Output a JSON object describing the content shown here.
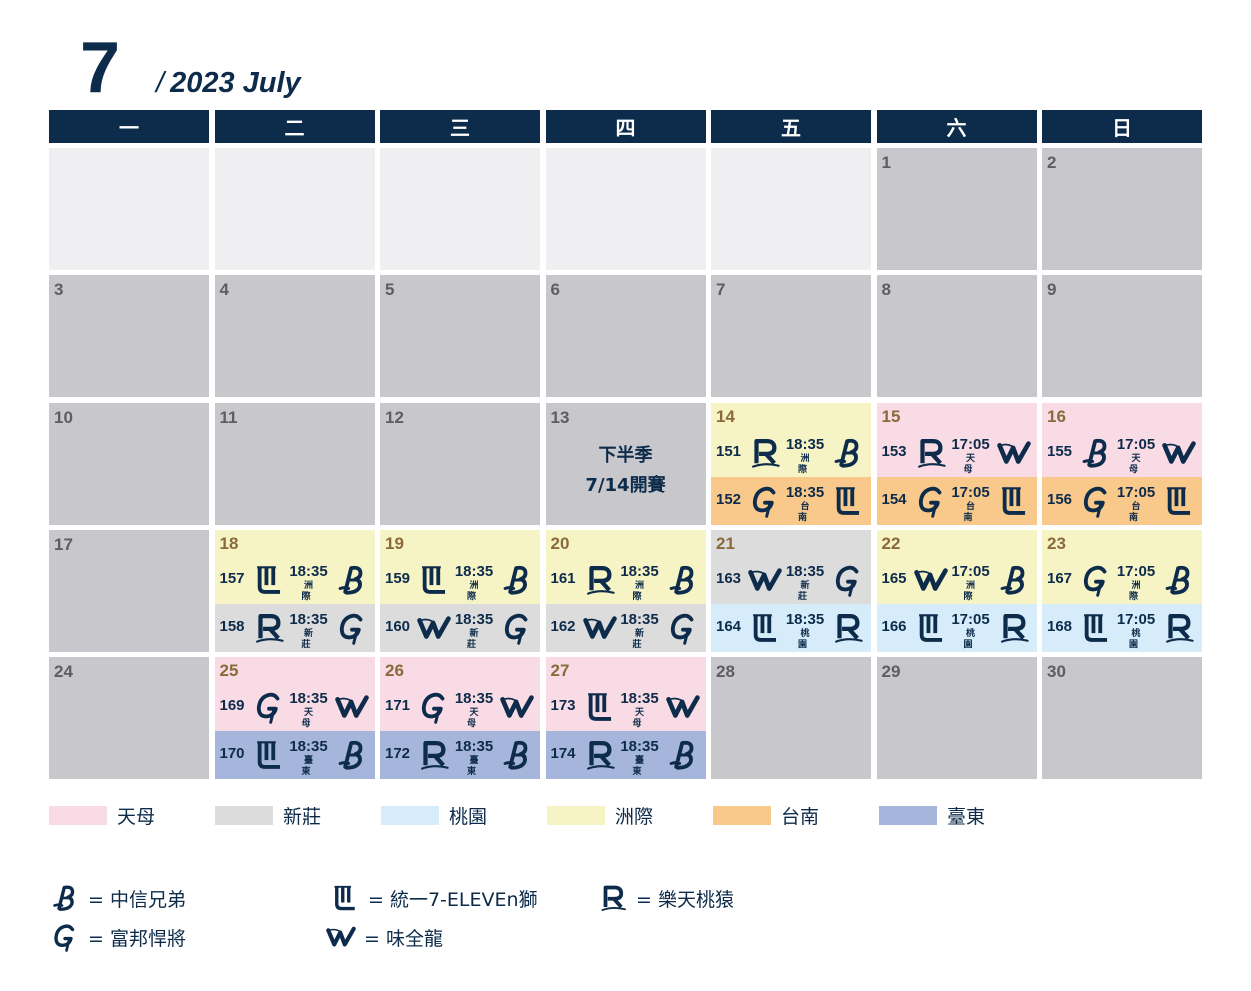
{
  "header": {
    "month_number": "7",
    "month_label": "2023 July",
    "separator": "/"
  },
  "weekdays": [
    "一",
    "二",
    "三",
    "四",
    "五",
    "六",
    "日"
  ],
  "colors": {
    "navy": "#0d2b4a",
    "tianmu": "#f9dbe5",
    "xinzhuang": "#dcdcdc",
    "taoyuan": "#d6ecfa",
    "zhouji": "#f6f3c5",
    "tainan": "#f8c98a",
    "taitung": "#a6b5dc"
  },
  "cells": [
    {
      "day": ""
    },
    {
      "day": ""
    },
    {
      "day": ""
    },
    {
      "day": ""
    },
    {
      "day": ""
    },
    {
      "day": "1"
    },
    {
      "day": "2"
    },
    {
      "day": "3"
    },
    {
      "day": "4"
    },
    {
      "day": "5"
    },
    {
      "day": "6"
    },
    {
      "day": "7"
    },
    {
      "day": "8"
    },
    {
      "day": "9"
    },
    {
      "day": "10"
    },
    {
      "day": "11"
    },
    {
      "day": "12"
    },
    {
      "day": "13",
      "note": [
        "下半季",
        "7/14開賽"
      ]
    },
    {
      "day": "14",
      "games": [
        {
          "no": "151",
          "away": "R",
          "home": "B",
          "time": "18:35",
          "venue": "洲 際",
          "vkey": "zhouji"
        },
        {
          "no": "152",
          "away": "G",
          "home": "L",
          "time": "18:35",
          "venue": "台 南",
          "vkey": "tainan"
        }
      ]
    },
    {
      "day": "15",
      "games": [
        {
          "no": "153",
          "away": "R",
          "home": "W",
          "time": "17:05",
          "venue": "天 母",
          "vkey": "tianmu"
        },
        {
          "no": "154",
          "away": "G",
          "home": "L",
          "time": "17:05",
          "venue": "台 南",
          "vkey": "tainan"
        }
      ]
    },
    {
      "day": "16",
      "games": [
        {
          "no": "155",
          "away": "B",
          "home": "W",
          "time": "17:05",
          "venue": "天 母",
          "vkey": "tianmu"
        },
        {
          "no": "156",
          "away": "G",
          "home": "L",
          "time": "17:05",
          "venue": "台 南",
          "vkey": "tainan"
        }
      ]
    },
    {
      "day": "17"
    },
    {
      "day": "18",
      "games": [
        {
          "no": "157",
          "away": "L",
          "home": "B",
          "time": "18:35",
          "venue": "洲 際",
          "vkey": "zhouji"
        },
        {
          "no": "158",
          "away": "R",
          "home": "G",
          "time": "18:35",
          "venue": "新 莊",
          "vkey": "xinzhuang"
        }
      ]
    },
    {
      "day": "19",
      "games": [
        {
          "no": "159",
          "away": "L",
          "home": "B",
          "time": "18:35",
          "venue": "洲 際",
          "vkey": "zhouji"
        },
        {
          "no": "160",
          "away": "W",
          "home": "G",
          "time": "18:35",
          "venue": "新 莊",
          "vkey": "xinzhuang"
        }
      ]
    },
    {
      "day": "20",
      "games": [
        {
          "no": "161",
          "away": "R",
          "home": "B",
          "time": "18:35",
          "venue": "洲 際",
          "vkey": "zhouji"
        },
        {
          "no": "162",
          "away": "W",
          "home": "G",
          "time": "18:35",
          "venue": "新 莊",
          "vkey": "xinzhuang"
        }
      ]
    },
    {
      "day": "21",
      "games": [
        {
          "no": "163",
          "away": "W",
          "home": "G",
          "time": "18:35",
          "venue": "新 莊",
          "vkey": "xinzhuang"
        },
        {
          "no": "164",
          "away": "L",
          "home": "R",
          "time": "18:35",
          "venue": "桃 園",
          "vkey": "taoyuan"
        }
      ]
    },
    {
      "day": "22",
      "games": [
        {
          "no": "165",
          "away": "W",
          "home": "B",
          "time": "17:05",
          "venue": "洲 際",
          "vkey": "zhouji"
        },
        {
          "no": "166",
          "away": "L",
          "home": "R",
          "time": "17:05",
          "venue": "桃 園",
          "vkey": "taoyuan"
        }
      ]
    },
    {
      "day": "23",
      "games": [
        {
          "no": "167",
          "away": "G",
          "home": "B",
          "time": "17:05",
          "venue": "洲 際",
          "vkey": "zhouji"
        },
        {
          "no": "168",
          "away": "L",
          "home": "R",
          "time": "17:05",
          "venue": "桃 園",
          "vkey": "taoyuan"
        }
      ]
    },
    {
      "day": "24"
    },
    {
      "day": "25",
      "games": [
        {
          "no": "169",
          "away": "G",
          "home": "W",
          "time": "18:35",
          "venue": "天 母",
          "vkey": "tianmu"
        },
        {
          "no": "170",
          "away": "L",
          "home": "B",
          "time": "18:35",
          "venue": "臺 東",
          "vkey": "taitung"
        }
      ]
    },
    {
      "day": "26",
      "games": [
        {
          "no": "171",
          "away": "G",
          "home": "W",
          "time": "18:35",
          "venue": "天 母",
          "vkey": "tianmu"
        },
        {
          "no": "172",
          "away": "R",
          "home": "B",
          "time": "18:35",
          "venue": "臺 東",
          "vkey": "taitung"
        }
      ]
    },
    {
      "day": "27",
      "games": [
        {
          "no": "173",
          "away": "L",
          "home": "W",
          "time": "18:35",
          "venue": "天 母",
          "vkey": "tianmu"
        },
        {
          "no": "174",
          "away": "R",
          "home": "B",
          "time": "18:35",
          "venue": "臺 東",
          "vkey": "taitung"
        }
      ]
    },
    {
      "day": "28"
    },
    {
      "day": "29"
    },
    {
      "day": "30"
    }
  ],
  "legend": [
    {
      "label": "天母",
      "vkey": "tianmu"
    },
    {
      "label": "新莊",
      "vkey": "xinzhuang"
    },
    {
      "label": "桃園",
      "vkey": "taoyuan"
    },
    {
      "label": "洲際",
      "vkey": "zhouji"
    },
    {
      "label": "台南",
      "vkey": "tainan"
    },
    {
      "label": "臺東",
      "vkey": "taitung"
    }
  ],
  "teams": [
    {
      "code": "B",
      "label": "= 中信兄弟",
      "icon": "brothers-logo-icon"
    },
    {
      "code": "L",
      "label": "= 統一7-ELEVEn獅",
      "icon": "lions-logo-icon"
    },
    {
      "code": "R",
      "label": "= 樂天桃猿",
      "icon": "monkeys-logo-icon"
    },
    {
      "code": "G",
      "label": "= 富邦悍將",
      "icon": "guardians-logo-icon"
    },
    {
      "code": "W",
      "label": "= 味全龍",
      "icon": "dragons-logo-icon"
    }
  ]
}
